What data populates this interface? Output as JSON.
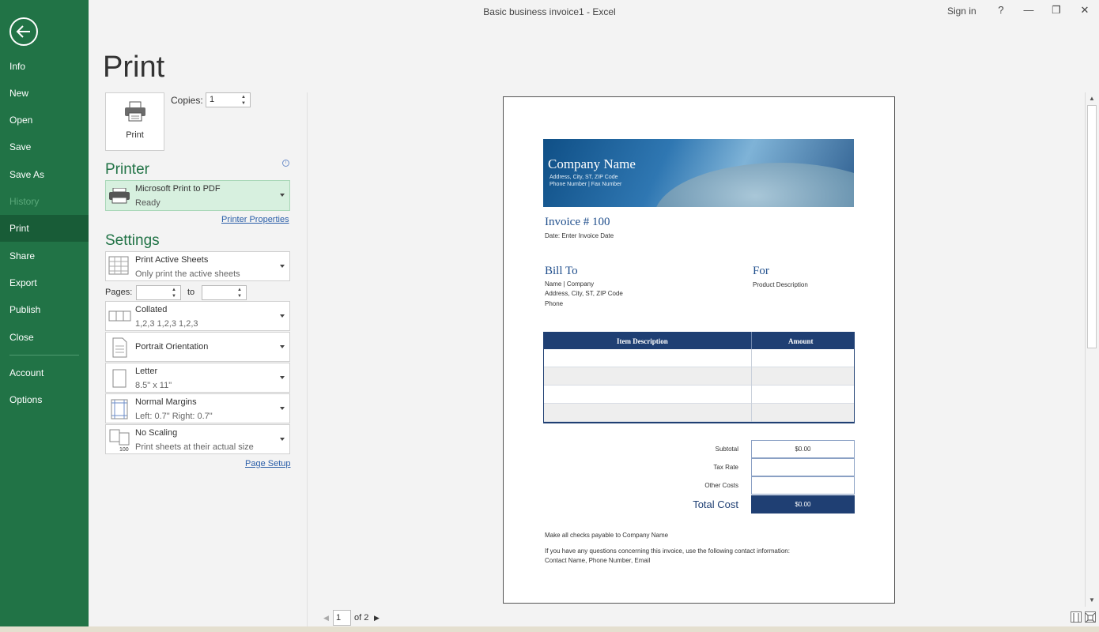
{
  "window": {
    "title": "Basic business invoice1  -  Excel",
    "sign_in": "Sign in",
    "help": "?",
    "minimize": "—",
    "restore": "❐",
    "close": "✕"
  },
  "sidebar": {
    "items": [
      {
        "label": "Info",
        "state": "normal"
      },
      {
        "label": "New",
        "state": "normal"
      },
      {
        "label": "Open",
        "state": "normal"
      },
      {
        "label": "Save",
        "state": "normal"
      },
      {
        "label": "Save As",
        "state": "normal"
      },
      {
        "label": "History",
        "state": "disabled"
      },
      {
        "label": "Print",
        "state": "active"
      },
      {
        "label": "Share",
        "state": "normal"
      },
      {
        "label": "Export",
        "state": "normal"
      },
      {
        "label": "Publish",
        "state": "normal"
      },
      {
        "label": "Close",
        "state": "normal"
      },
      {
        "label": "Account",
        "state": "normal"
      },
      {
        "label": "Options",
        "state": "normal"
      }
    ]
  },
  "panel": {
    "heading": "Print",
    "print_button": "Print",
    "copies_label": "Copies:",
    "copies_value": "1",
    "printer_heading": "Printer",
    "info_icon": "i",
    "printer_name": "Microsoft Print to PDF",
    "printer_status": "Ready",
    "printer_properties": "Printer Properties",
    "settings_heading": "Settings",
    "pages_label": "Pages:",
    "to_label": "to",
    "page_setup": "Page Setup",
    "settings": {
      "what": {
        "line1": "Print Active Sheets",
        "line2": "Only print the active sheets"
      },
      "collation": {
        "line1": "Collated",
        "line2": "1,2,3     1,2,3     1,2,3"
      },
      "orientation": {
        "line1": "Portrait Orientation"
      },
      "paper": {
        "line1": "Letter",
        "line2": "8.5\" x 11\""
      },
      "margins": {
        "line1": "Normal Margins",
        "line2": "Left:  0.7\"    Right:  0.7\""
      },
      "scaling": {
        "line1": "No Scaling",
        "line2": "Print sheets at their actual size"
      }
    }
  },
  "preview": {
    "company_name": "Company Name",
    "company_address": "Address, City, ST, ZIP Code",
    "company_phone": "Phone Number  |  Fax Number",
    "invoice_title": "Invoice # 100",
    "invoice_date": "Date: Enter Invoice Date",
    "bill_to": "Bill To",
    "bill_name": "Name  |  Company",
    "bill_address": "Address, City, ST, ZIP Code",
    "bill_phone": "Phone",
    "for_title": "For",
    "for_desc": "Product Description",
    "col_item": "Item Description",
    "col_amount": "Amount",
    "subtotal_label": "Subtotal",
    "subtotal_value": "$0.00",
    "tax_label": "Tax Rate",
    "other_label": "Other Costs",
    "total_label": "Total Cost",
    "total_value": "$0.00",
    "checks_note": "Make all checks payable to Company Name",
    "questions_note": "If you have any questions concerning this invoice, use the following contact information:",
    "contact_note": "Contact Name, Phone Number, Email",
    "brand_color": "#1f3f73"
  },
  "navigation": {
    "current_page": "1",
    "of_pages": "of 2"
  },
  "colors": {
    "sidebar": "#217346",
    "sidebar_active": "#185c37",
    "accent": "#217346"
  }
}
